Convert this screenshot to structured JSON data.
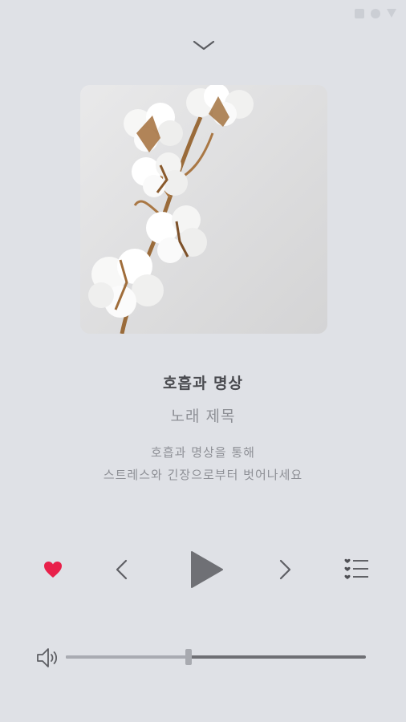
{
  "header": {
    "collapse_icon": "chevron-down-icon",
    "status_icons": [
      "square-icon",
      "circle-icon",
      "triangle-icon"
    ]
  },
  "album": {
    "art": "cotton-branch-photo"
  },
  "track": {
    "title": "호흡과 명상",
    "subtitle": "노래 제목",
    "description_line1": "호흡과 명상을 통해",
    "description_line2": "스트레스와 긴장으로부터 벗어나세요"
  },
  "controls": {
    "like_icon": "heart-icon",
    "prev_icon": "chevron-left-icon",
    "play_icon": "play-icon",
    "next_icon": "chevron-right-icon",
    "playlist_icon": "playlist-icon"
  },
  "volume": {
    "icon": "speaker-icon",
    "level": 0.41
  },
  "colors": {
    "background": "#dfe1e6",
    "accent_heart": "#e8204a",
    "control_gray": "#6f7075"
  }
}
